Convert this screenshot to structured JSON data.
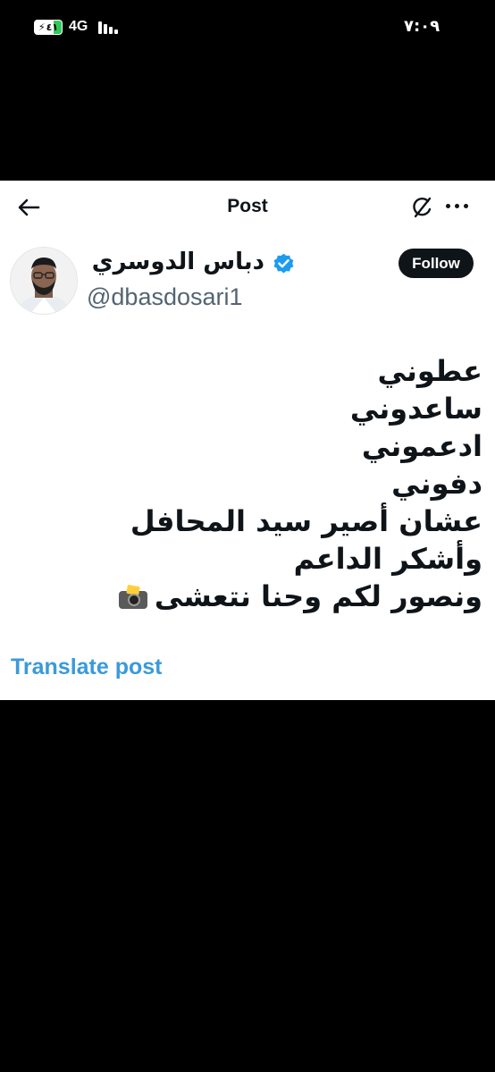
{
  "status_bar": {
    "battery_level": "٤١",
    "network": "4G",
    "time": "٧:٠٩",
    "battery_color": "#34c759",
    "icons": [
      "charging-bolt-icon",
      "cellular-signal-icon"
    ]
  },
  "header": {
    "title": "Post",
    "icons": [
      "back-arrow-icon",
      "grok-icon",
      "more-options-icon"
    ]
  },
  "author": {
    "display_name": "دباس الدوسري",
    "handle": "@dbasdosari1",
    "verified": true,
    "verified_color": "#1d9bf0",
    "follow_label": "Follow"
  },
  "post": {
    "lines": [
      "عطوني",
      "ساعدوني",
      "ادعموني",
      "دفوني",
      "عشان أصير سيد المحافل",
      "وأشكر الداعم",
      "ونصور لكم وحنا نتعشى"
    ],
    "trailing_emoji": "camera-with-flash-icon"
  },
  "translate_label": "Translate post",
  "colors": {
    "accent": "#3a9ad9",
    "text": "#0f1419",
    "secondary": "#536471",
    "background": "#000000",
    "panel": "#ffffff"
  }
}
